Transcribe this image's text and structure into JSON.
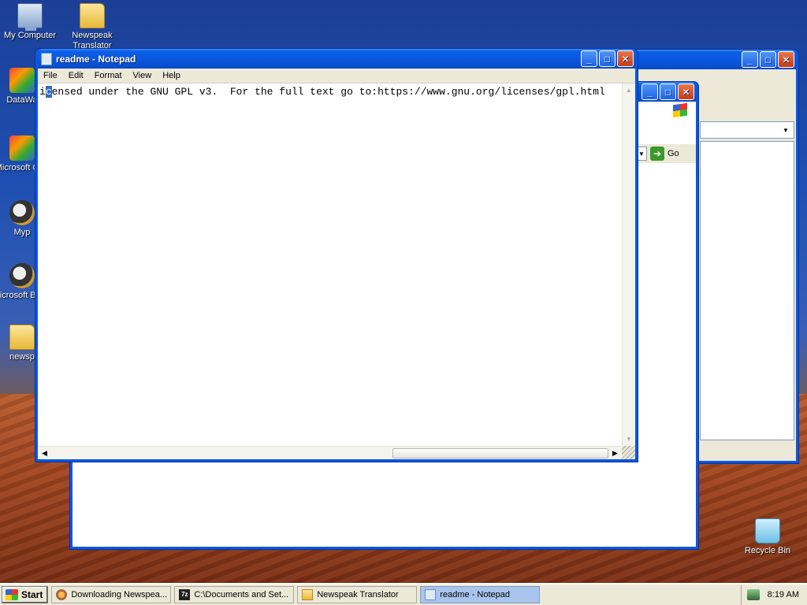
{
  "desktop": {
    "icons": [
      {
        "label": "My Computer",
        "icon": "computer-icon"
      },
      {
        "label": "Newspeak Translator",
        "icon": "folder-icon"
      },
      {
        "label": "DataWa",
        "icon": "app-icon"
      },
      {
        "label": "Microsoft C++",
        "icon": "shortcut-icon"
      },
      {
        "label": "Myp",
        "icon": "app-icon"
      },
      {
        "label": "Microsoft Basic",
        "icon": "shortcut-icon"
      },
      {
        "label": "newsp",
        "icon": "file-icon"
      },
      {
        "label": "Recycle Bin",
        "icon": "recycle-bin-icon"
      }
    ]
  },
  "notepad": {
    "title": "readme - Notepad",
    "menu": [
      "File",
      "Edit",
      "Format",
      "View",
      "Help"
    ],
    "text_before": "i",
    "text_selected": "c",
    "text_after": "ensed under the GNU GPL v3.  For the full text go to:https://www.gnu.org/licenses/gpl.html"
  },
  "explorer": {
    "go_label": "Go"
  },
  "taskbar": {
    "start_label": "Start",
    "tasks": [
      {
        "label": "Downloading Newspea...",
        "icon": "download-icon"
      },
      {
        "label": "C:\\Documents and Set...",
        "icon": "7zip-icon"
      },
      {
        "label": "Newspeak Translator",
        "icon": "folder-icon"
      },
      {
        "label": "readme - Notepad",
        "icon": "notepad-icon",
        "active": true
      }
    ],
    "clock": "8:19 AM"
  },
  "colors": {
    "title_bar": "#0a58e0",
    "selection": "#316ac5",
    "taskbar": "#ece9d8"
  }
}
